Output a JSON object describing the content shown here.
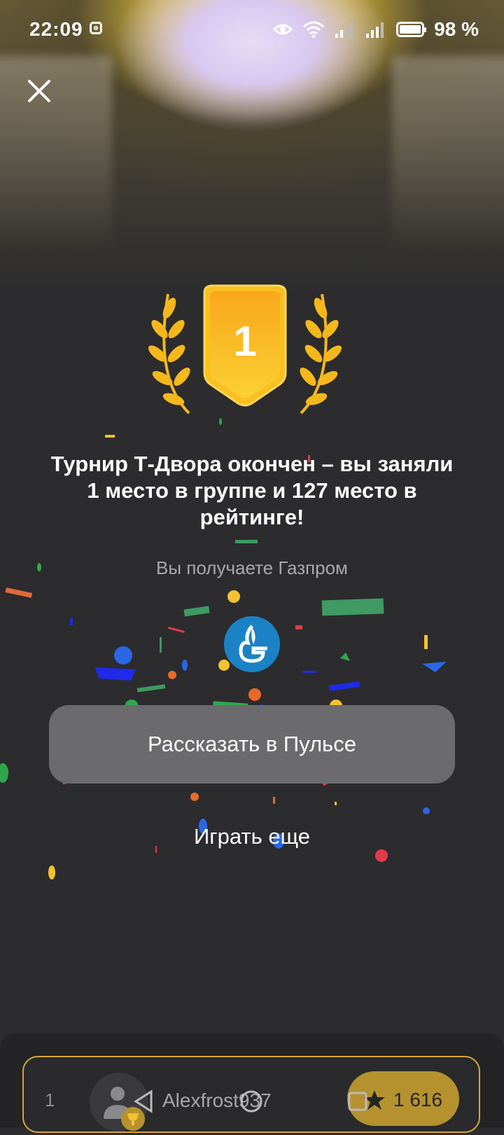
{
  "status_bar": {
    "time": "22:09",
    "battery": "98 %",
    "icons": [
      "instagram-icon",
      "eye-icon",
      "wifi-icon",
      "signal-icon",
      "signal-icon",
      "battery-icon"
    ]
  },
  "header": {
    "close_icon": "close-icon"
  },
  "badge": {
    "place": "1",
    "laurel_color": "#f4b81c",
    "shield_color": "#f9c021"
  },
  "headline": "Турнир Т-Двора окончен – вы заняли 1 место в группе и 127 место в рейтинге!",
  "reward": {
    "subtitle": "Вы получаете Газпром",
    "logo_icon": "gazprom-logo",
    "logo_color": "#1b82c5"
  },
  "buttons": {
    "share": "Рассказать в Пульсе",
    "play_again": "Играть еще"
  },
  "leaderboard": {
    "rank": "1",
    "username": "Alexfrost937",
    "score": "1 616",
    "accent": "#d9a53a"
  },
  "colors": {
    "background": "#2c2c2e",
    "button": "#6b6b6e",
    "subtitle": "#a9a9ad"
  }
}
